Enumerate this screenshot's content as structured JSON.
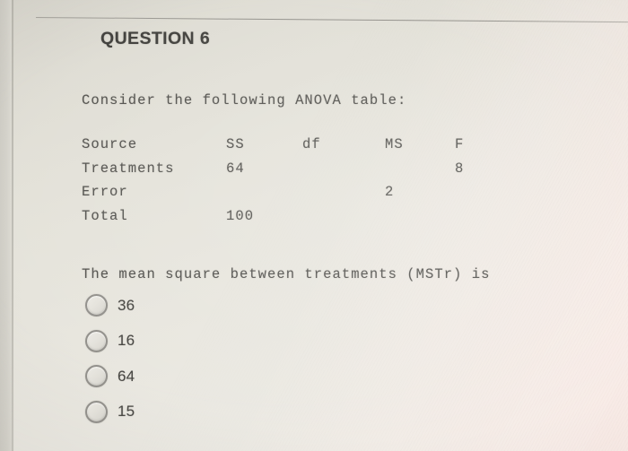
{
  "header": {
    "question_title": "QUESTION 6"
  },
  "body": {
    "intro_text": "Consider the following ANOVA table:",
    "prompt_text": "The mean square between treatments (MSTr) is"
  },
  "anova_table": {
    "columns": [
      "Source",
      "SS",
      "df",
      "MS",
      "F"
    ],
    "rows": [
      {
        "source": "Treatments",
        "ss": "64",
        "df": "",
        "ms": "",
        "f": "8"
      },
      {
        "source": "Error",
        "ss": "",
        "df": "",
        "ms": "2",
        "f": ""
      },
      {
        "source": "Total",
        "ss": "100",
        "df": "",
        "ms": "",
        "f": ""
      }
    ]
  },
  "options": [
    {
      "label": "36",
      "selected": false
    },
    {
      "label": "16",
      "selected": false
    },
    {
      "label": "64",
      "selected": false
    },
    {
      "label": "15",
      "selected": false
    }
  ],
  "colors": {
    "page_background": "#e7e5dd",
    "text": "#4c4b47",
    "heading": "#3b3a36",
    "radio_border": "#8d8b86",
    "divider": "#8c8a84"
  }
}
